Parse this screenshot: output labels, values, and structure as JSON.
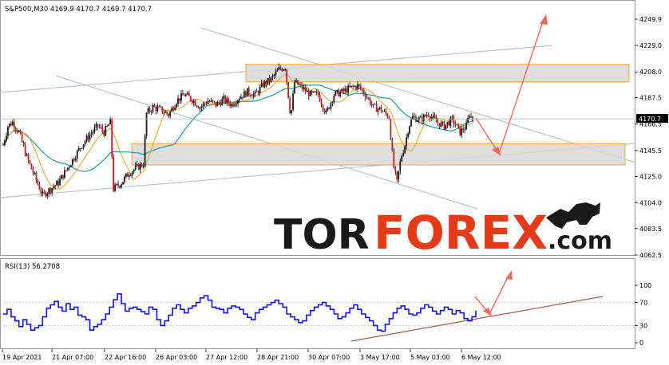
{
  "chart_header": "S&P500,M30  4169.9 4170.7 4169.7 4170.7",
  "rsi_header": "RSI(13) 56.2708",
  "current_price_label": "4170.7",
  "brand": {
    "part1": "TOR",
    "part2": "FOREX",
    "part3": ".com"
  },
  "chart_data": [
    {
      "type": "candlestick",
      "title": "S&P500,M30",
      "ohlc_last": {
        "open": 4169.9,
        "high": 4170.7,
        "low": 4169.7,
        "close": 4170.7
      },
      "y_ticks": [
        4249.9,
        4229.0,
        4208.0,
        4187.5,
        4166.5,
        4145.5,
        4125.0,
        4104.0,
        4083.5,
        4062.5
      ],
      "ylim": [
        4060,
        4255
      ],
      "current_price": 4170.7,
      "x_tick_labels": [
        "19 Apr 2021",
        "21 Apr 07:00",
        "22 Apr 16:00",
        "26 Apr 03:00",
        "27 Apr 12:00",
        "28 Apr 21:00",
        "30 Apr 07:00",
        "3 May 17:00",
        "5 May 03:00",
        "6 May 12:00"
      ],
      "price_path": [
        [
          0,
          4150
        ],
        [
          6,
          4165
        ],
        [
          12,
          4168
        ],
        [
          20,
          4160
        ],
        [
          30,
          4140
        ],
        [
          40,
          4125
        ],
        [
          50,
          4110
        ],
        [
          60,
          4115
        ],
        [
          70,
          4120
        ],
        [
          80,
          4130
        ],
        [
          90,
          4140
        ],
        [
          100,
          4150
        ],
        [
          110,
          4158
        ],
        [
          120,
          4165
        ],
        [
          128,
          4160
        ],
        [
          136,
          4168
        ],
        [
          140,
          4115
        ],
        [
          150,
          4120
        ],
        [
          160,
          4128
        ],
        [
          170,
          4132
        ],
        [
          178,
          4135
        ],
        [
          182,
          4175
        ],
        [
          190,
          4180
        ],
        [
          200,
          4178
        ],
        [
          210,
          4174
        ],
        [
          220,
          4185
        ],
        [
          230,
          4190
        ],
        [
          240,
          4186
        ],
        [
          250,
          4180
        ],
        [
          260,
          4185
        ],
        [
          270,
          4182
        ],
        [
          280,
          4186
        ],
        [
          290,
          4182
        ],
        [
          300,
          4188
        ],
        [
          310,
          4192
        ],
        [
          320,
          4190
        ],
        [
          330,
          4198
        ],
        [
          340,
          4202
        ],
        [
          350,
          4210
        ],
        [
          358,
          4212
        ],
        [
          365,
          4172
        ],
        [
          370,
          4200
        ],
        [
          380,
          4195
        ],
        [
          390,
          4190
        ],
        [
          400,
          4190
        ],
        [
          410,
          4175
        ],
        [
          420,
          4190
        ],
        [
          430,
          4192
        ],
        [
          440,
          4195
        ],
        [
          450,
          4197
        ],
        [
          460,
          4190
        ],
        [
          470,
          4180
        ],
        [
          480,
          4178
        ],
        [
          490,
          4172
        ],
        [
          495,
          4135
        ],
        [
          500,
          4120
        ],
        [
          505,
          4140
        ],
        [
          510,
          4150
        ],
        [
          515,
          4165
        ],
        [
          520,
          4172
        ],
        [
          530,
          4170
        ],
        [
          540,
          4175
        ],
        [
          550,
          4168
        ],
        [
          560,
          4165
        ],
        [
          570,
          4170
        ],
        [
          580,
          4160
        ],
        [
          588,
          4165
        ],
        [
          592,
          4175
        ],
        [
          596,
          4170
        ]
      ],
      "zones": [
        {
          "from": 4214,
          "to": 4200
        },
        {
          "from": 4151,
          "to": 4134
        }
      ]
    },
    {
      "type": "line",
      "title": "RSI(13)",
      "last_value": 56.2708,
      "y_ticks": [
        100,
        70,
        30,
        0
      ],
      "ylim": [
        0,
        100
      ],
      "series": [
        {
          "values": [
            50,
            58,
            45,
            38,
            28,
            40,
            32,
            22,
            26,
            30,
            45,
            60,
            66,
            72,
            62,
            55,
            68,
            58,
            62,
            48,
            45,
            40,
            22,
            28,
            32,
            40,
            50,
            62,
            75,
            85,
            68,
            55,
            60,
            62,
            58,
            54,
            50,
            62,
            58,
            40,
            30,
            38,
            48,
            60,
            66,
            58,
            52,
            60,
            64,
            70,
            78,
            82,
            74,
            62,
            60,
            58,
            52,
            60,
            64,
            62,
            58,
            50,
            44,
            40,
            52,
            58,
            62,
            66,
            70,
            74,
            68,
            62,
            50,
            45,
            40,
            35,
            38,
            48,
            56,
            62,
            66,
            70,
            64,
            58,
            50,
            42,
            45,
            52,
            60,
            66,
            58,
            50,
            44,
            38,
            30,
            22,
            20,
            32,
            42,
            52,
            60,
            64,
            58,
            50,
            48,
            52,
            60,
            66,
            62,
            55,
            50,
            56,
            62,
            58,
            50,
            56,
            52,
            42,
            38,
            45,
            56
          ]
        }
      ]
    }
  ]
}
